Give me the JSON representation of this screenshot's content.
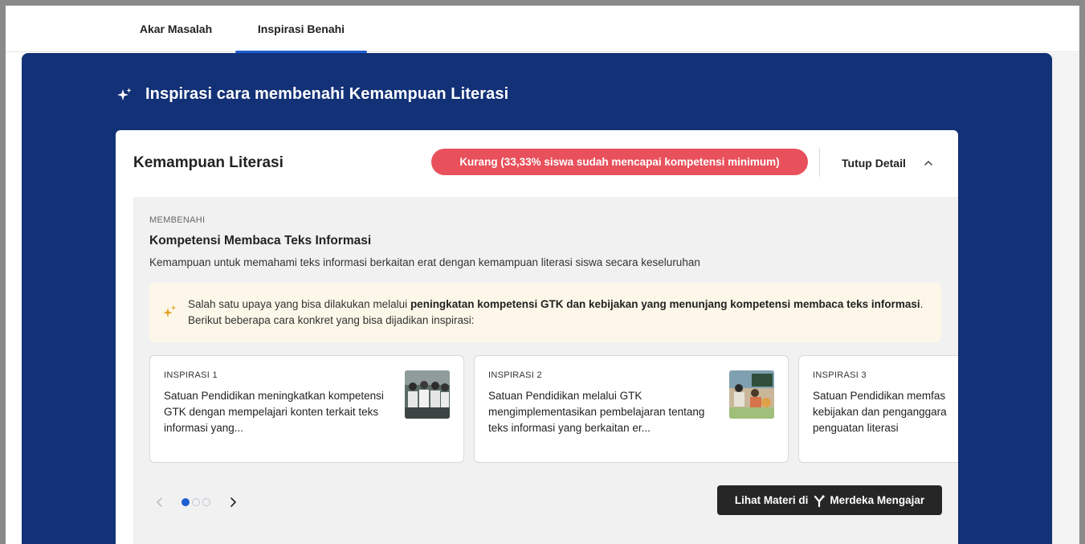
{
  "tabs": [
    {
      "label": "Akar Masalah",
      "active": false
    },
    {
      "label": "Inspirasi Benahi",
      "active": true
    }
  ],
  "panel": {
    "icon": "sparkle-icon",
    "title": "Inspirasi cara membenahi Kemampuan Literasi"
  },
  "card": {
    "title": "Kemampuan Literasi",
    "status": "Kurang (33,33% siswa sudah mencapai kompetensi minimum)",
    "status_color": "#e8505b",
    "toggle_label": "Tutup Detail",
    "toggle_icon": "chevron-up-icon"
  },
  "section": {
    "overline": "MEMBENAHI",
    "title": "Kompetensi Membaca Teks Informasi",
    "description": "Kemampuan untuk memahami teks informasi berkaitan erat dengan kemampuan literasi siswa secara keseluruhan"
  },
  "callout": {
    "icon": "sparkle-icon",
    "text_pre": "Salah satu upaya yang bisa dilakukan melalui ",
    "text_bold": "peningkatan kompetensi GTK dan kebijakan yang menunjang kompetensi membaca teks informasi",
    "text_post": ". Berikut beberapa cara konkret yang bisa dijadikan inspirasi:"
  },
  "inspirations": [
    {
      "label": "INSPIRASI 1",
      "text": "Satuan Pendidikan meningkatkan kompetensi GTK dengan mempelajari konten terkait teks informasi yang..."
    },
    {
      "label": "INSPIRASI 2",
      "text": "Satuan Pendidikan melalui GTK mengimplementasikan pembelajaran tentang teks informasi yang berkaitan er..."
    },
    {
      "label": "INSPIRASI 3",
      "text": "Satuan Pendidikan memfas kebijakan dan penganggara penguatan literasi"
    }
  ],
  "pager": {
    "current": 1,
    "total": 3
  },
  "cta": {
    "label_pre": "Lihat Materi di",
    "label_brand": "Merdeka Mengajar"
  },
  "colors": {
    "panel_bg": "#133176",
    "accent": "#1f5fd1",
    "callout_bg": "#fcf7e8",
    "cta_bg": "#262626"
  }
}
